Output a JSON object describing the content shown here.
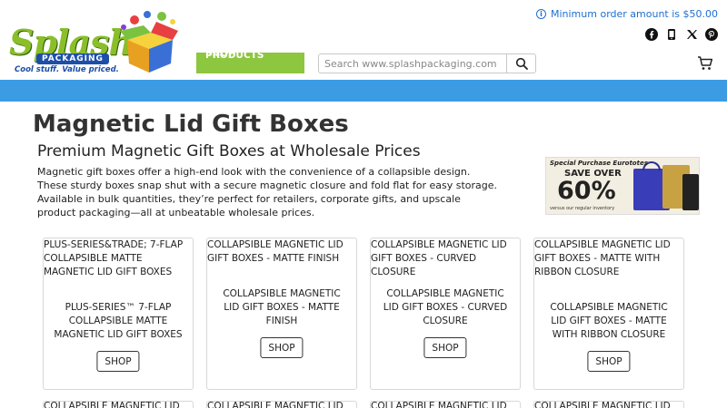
{
  "logo": {
    "wordmark": "Splash",
    "sub": "PACKAGING",
    "tagline": "Cool stuff. Value priced."
  },
  "header": {
    "min_order": "Minimum order amount is $50.00",
    "social_icons": [
      "facebook-icon",
      "mobile-icon",
      "x-icon",
      "pinterest-icon"
    ],
    "shop_products_label": "SHOP PRODUCTS",
    "search_placeholder": "Search www.splashpackaging.com",
    "accent_color": "#8dc63f",
    "bar_color": "#3b9ce3"
  },
  "main": {
    "title": "Magnetic Lid Gift Boxes",
    "subtitle": "Premium Magnetic Gift Boxes at Wholesale Prices",
    "description": "Magnetic gift boxes offer a high-end look with the convenience of a collapsible design. These sturdy boxes snap shut with a secure magnetic closure and fold flat for easy storage. Available in bulk quantities, they’re perfect for retailers, corporate gifts, and upscale product packaging—all at unbeatable wholesale prices."
  },
  "promo": {
    "top": "Special Purchase Eurototes",
    "save": "SAVE OVER",
    "percent": "60%",
    "sub": "versus our regular inventory"
  },
  "products": [
    {
      "head": "PLUS-SERIES&TRADE; 7-FLAP COLLAPSIBLE MATTE MAGNETIC LID GIFT BOXES",
      "name": "PLUS-SERIES™ 7-FLAP COLLAPSIBLE MATTE MAGNETIC LID GIFT BOXES",
      "shop": "SHOP"
    },
    {
      "head": "COLLAPSIBLE MAGNETIC LID GIFT BOXES - MATTE FINISH",
      "name": "COLLAPSIBLE MAGNETIC LID GIFT BOXES - MATTE FINISH",
      "shop": "SHOP"
    },
    {
      "head": "COLLAPSIBLE MAGNETIC LID GIFT BOXES - CURVED CLOSURE",
      "name": "COLLAPSIBLE MAGNETIC LID GIFT BOXES - CURVED CLOSURE",
      "shop": "SHOP"
    },
    {
      "head": "COLLAPSIBLE MAGNETIC LID GIFT BOXES - MATTE WITH RIBBON CLOSURE",
      "name": "COLLAPSIBLE MAGNETIC LID GIFT BOXES - MATTE WITH RIBBON CLOSURE",
      "shop": "SHOP"
    }
  ],
  "next_row": [
    "COLLAPSIBLE MAGNETIC LID",
    "COLLAPSIBLE MAGNETIC LID",
    "COLLAPSIBLE MAGNETIC LID",
    "COLLAPSIBLE MAGNETIC LID"
  ]
}
